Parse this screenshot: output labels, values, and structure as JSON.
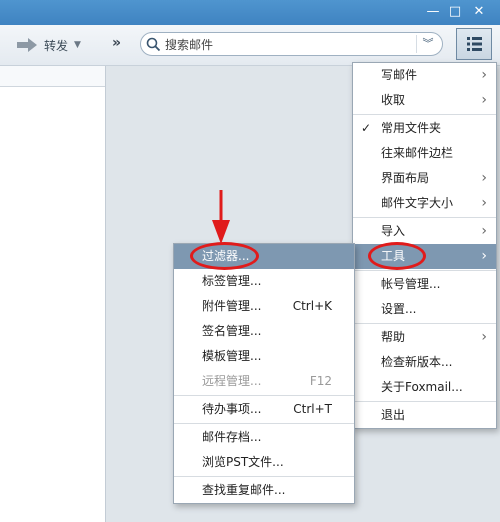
{
  "window": {
    "minimize": "—",
    "maximize": "□",
    "close": "✕"
  },
  "toolbar": {
    "forward_label": "转发",
    "more_label": "»",
    "search_placeholder": "搜索邮件"
  },
  "main_menu": {
    "items": [
      {
        "label": "写邮件",
        "arrow": "›"
      },
      {
        "label": "收取",
        "arrow": "›"
      },
      {
        "label": "常用文件夹",
        "check": "✓"
      },
      {
        "label": "往来邮件边栏"
      },
      {
        "label": "界面布局",
        "arrow": "›"
      },
      {
        "label": "邮件文字大小",
        "arrow": "›"
      },
      {
        "label": "导入",
        "arrow": "›"
      },
      {
        "label": "工具",
        "arrow": "›"
      },
      {
        "label": "帐号管理..."
      },
      {
        "label": "设置..."
      },
      {
        "label": "帮助",
        "arrow": "›"
      },
      {
        "label": "检查新版本..."
      },
      {
        "label": "关于Foxmail..."
      },
      {
        "label": "退出"
      }
    ]
  },
  "tools_menu": {
    "items": [
      {
        "label": "过滤器..."
      },
      {
        "label": "标签管理..."
      },
      {
        "label": "附件管理...",
        "shortcut": "Ctrl+K"
      },
      {
        "label": "签名管理..."
      },
      {
        "label": "模板管理..."
      },
      {
        "label": "远程管理...",
        "shortcut": "F12"
      },
      {
        "label": "待办事项...",
        "shortcut": "Ctrl+T"
      },
      {
        "label": "邮件存档..."
      },
      {
        "label": "浏览PST文件..."
      },
      {
        "label": "查找重复邮件..."
      }
    ]
  },
  "colors": {
    "highlight": "#7e98b1",
    "annotation": "#e01b1b",
    "titlebar": "#4f95cf"
  }
}
